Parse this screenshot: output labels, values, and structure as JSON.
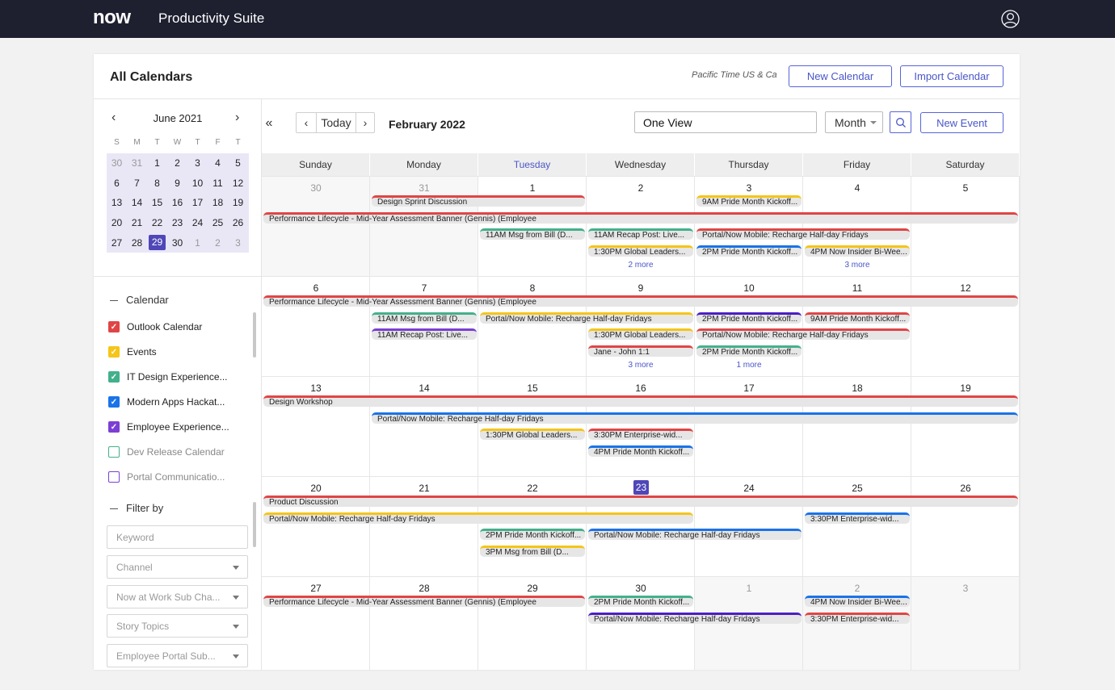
{
  "app": {
    "logo": "now",
    "title": "Productivity Suite"
  },
  "panel": {
    "title": "All Calendars",
    "timezone": "Pacific Time US & Ca",
    "new_calendar": "New Calendar",
    "import_calendar": "Import Calendar"
  },
  "mini_calendar": {
    "month": "June 2021",
    "weekdays": [
      "S",
      "M",
      "T",
      "W",
      "T",
      "F",
      "T"
    ],
    "weeks": [
      [
        "30",
        "31",
        "1",
        "2",
        "3",
        "4",
        "5"
      ],
      [
        "6",
        "7",
        "8",
        "9",
        "10",
        "11",
        "12"
      ],
      [
        "13",
        "14",
        "15",
        "16",
        "17",
        "18",
        "19"
      ],
      [
        "20",
        "21",
        "22",
        "23",
        "24",
        "25",
        "26"
      ],
      [
        "27",
        "28",
        "29",
        "30",
        "1",
        "2",
        "3"
      ]
    ],
    "selected": "29"
  },
  "calendar_section": {
    "title": "Calendar",
    "items": [
      {
        "label": "Outlook Calendar",
        "color": "#e04545",
        "checked": true
      },
      {
        "label": "Events",
        "color": "#f5c518",
        "checked": true
      },
      {
        "label": "IT Design Experience...",
        "color": "#43b08c",
        "checked": true
      },
      {
        "label": "Modern Apps Hackat...",
        "color": "#1a73e8",
        "checked": true
      },
      {
        "label": "Employee Experience...",
        "color": "#7b3fd4",
        "checked": true
      },
      {
        "label": "Dev Release Calendar",
        "color": "#43b08c",
        "checked": false
      },
      {
        "label": "Portal Communicatio...",
        "color": "#7b3fd4",
        "checked": false
      }
    ]
  },
  "filter_section": {
    "title": "Filter by",
    "keyword_placeholder": "Keyword",
    "channel": "Channel",
    "now_at_work": "Now at Work Sub Cha...",
    "story_topics": "Story Topics",
    "employee_portal": "Employee Portal Sub..."
  },
  "toolbar": {
    "today": "Today",
    "period": "February 2022",
    "view_name": "One View",
    "view_mode": "Month",
    "new_event": "New Event"
  },
  "calendar": {
    "weekdays": [
      "Sunday",
      "Monday",
      "Tuesday",
      "Wednesday",
      "Thursday",
      "Friday",
      "Saturday"
    ],
    "today_column": "Tuesday",
    "weeks": [
      {
        "days": [
          "30",
          "31",
          "1",
          "2",
          "3",
          "4",
          "5"
        ],
        "muted": [
          0,
          1
        ],
        "events": [
          {
            "title": "Design Sprint Discussion",
            "start": 1,
            "span": 2,
            "lane": 0,
            "color": "#e04545"
          },
          {
            "title": "9AM Pride Month Kickoff...",
            "start": 4,
            "span": 1,
            "lane": 0,
            "color": "#f5c518"
          },
          {
            "title": "Performance Lifecycle - Mid-Year Assessment Banner (Gennis) (Employee",
            "start": 0,
            "span": 7,
            "lane": 1,
            "color": "#e04545"
          },
          {
            "title": "11AM Msg from Bill (D...",
            "start": 2,
            "span": 1,
            "lane": 2,
            "color": "#43b08c"
          },
          {
            "title": "11AM Recap Post: Live...",
            "start": 3,
            "span": 1,
            "lane": 2,
            "color": "#43b08c"
          },
          {
            "title": "Portal/Now Mobile: Recharge Half-day Fridays",
            "start": 4,
            "span": 2,
            "lane": 2,
            "color": "#e04545"
          },
          {
            "title": "1:30PM Global Leaders...",
            "start": 3,
            "span": 1,
            "lane": 3,
            "color": "#f5c518"
          },
          {
            "title": "2PM Pride Month Kickoff...",
            "start": 4,
            "span": 1,
            "lane": 3,
            "color": "#1a73e8"
          },
          {
            "title": "4PM Now Insider Bi-Wee...",
            "start": 5,
            "span": 1,
            "lane": 3,
            "color": "#f5c518"
          }
        ],
        "more": [
          {
            "col": 3,
            "text": "2 more"
          },
          {
            "col": 5,
            "text": "3 more"
          }
        ]
      },
      {
        "days": [
          "6",
          "7",
          "8",
          "9",
          "10",
          "11",
          "12"
        ],
        "muted": [],
        "events": [
          {
            "title": "Performance Lifecycle - Mid-Year Assessment Banner (Gennis) (Employee",
            "start": 0,
            "span": 7,
            "lane": 0,
            "color": "#e04545"
          },
          {
            "title": "11AM Msg from Bill (D...",
            "start": 1,
            "span": 1,
            "lane": 1,
            "color": "#43b08c"
          },
          {
            "title": "Portal/Now Mobile: Recharge Half-day Fridays",
            "start": 2,
            "span": 2,
            "lane": 1,
            "color": "#f5c518"
          },
          {
            "title": "2PM Pride Month Kickoff...",
            "start": 4,
            "span": 1,
            "lane": 1,
            "color": "#4b1fc4"
          },
          {
            "title": "9AM Pride Month Kickoff...",
            "start": 5,
            "span": 1,
            "lane": 1,
            "color": "#e04545"
          },
          {
            "title": "11AM Recap Post: Live...",
            "start": 1,
            "span": 1,
            "lane": 2,
            "color": "#7b3fd4"
          },
          {
            "title": "1:30PM Global Leaders...",
            "start": 3,
            "span": 1,
            "lane": 2,
            "color": "#f5c518"
          },
          {
            "title": "Portal/Now Mobile: Recharge Half-day Fridays",
            "start": 4,
            "span": 2,
            "lane": 2,
            "color": "#e04545"
          },
          {
            "title": "Jane - John 1:1",
            "start": 3,
            "span": 1,
            "lane": 3,
            "color": "#e04545"
          },
          {
            "title": "2PM Pride Month Kickoff...",
            "start": 4,
            "span": 1,
            "lane": 3,
            "color": "#43b08c"
          }
        ],
        "more": [
          {
            "col": 3,
            "text": "3 more"
          },
          {
            "col": 4,
            "text": "1 more"
          }
        ]
      },
      {
        "days": [
          "13",
          "14",
          "15",
          "16",
          "17",
          "18",
          "19"
        ],
        "muted": [],
        "events": [
          {
            "title": "Design Workshop",
            "start": 0,
            "span": 7,
            "lane": 0,
            "color": "#e04545"
          },
          {
            "title": "Portal/Now Mobile: Recharge Half-day Fridays",
            "start": 1,
            "span": 6,
            "lane": 1,
            "color": "#1a73e8"
          },
          {
            "title": "1:30PM Global Leaders...",
            "start": 2,
            "span": 1,
            "lane": 2,
            "color": "#f5c518"
          },
          {
            "title": "3:30PM Enterprise-wid...",
            "start": 3,
            "span": 1,
            "lane": 2,
            "color": "#e04545"
          },
          {
            "title": "4PM Pride Month Kickoff...",
            "start": 3,
            "span": 1,
            "lane": 3,
            "color": "#1a73e8"
          }
        ],
        "more": []
      },
      {
        "days": [
          "20",
          "21",
          "22",
          "23",
          "24",
          "25",
          "26"
        ],
        "muted": [],
        "current": 3,
        "events": [
          {
            "title": "Product Discussion",
            "start": 0,
            "span": 7,
            "lane": 0,
            "color": "#e04545"
          },
          {
            "title": "Portal/Now Mobile: Recharge Half-day Fridays",
            "start": 0,
            "span": 4,
            "lane": 1,
            "color": "#f5c518"
          },
          {
            "title": "3:30PM Enterprise-wid...",
            "start": 5,
            "span": 1,
            "lane": 1,
            "color": "#1a73e8"
          },
          {
            "title": "2PM Pride Month Kickoff...",
            "start": 2,
            "span": 1,
            "lane": 2,
            "color": "#43b08c"
          },
          {
            "title": "Portal/Now Mobile: Recharge Half-day Fridays",
            "start": 3,
            "span": 2,
            "lane": 2,
            "color": "#1a73e8"
          },
          {
            "title": "3PM Msg from Bill (D...",
            "start": 2,
            "span": 1,
            "lane": 3,
            "color": "#f5c518"
          }
        ],
        "more": []
      },
      {
        "days": [
          "27",
          "28",
          "29",
          "30",
          "1",
          "2",
          "3"
        ],
        "muted": [
          4,
          5,
          6
        ],
        "events": [
          {
            "title": "Performance Lifecycle - Mid-Year Assessment Banner (Gennis) (Employee",
            "start": 0,
            "span": 3,
            "lane": 0,
            "color": "#e04545"
          },
          {
            "title": "2PM Pride Month Kickoff...",
            "start": 3,
            "span": 1,
            "lane": 0,
            "color": "#43b08c"
          },
          {
            "title": "4PM Now Insider Bi-Wee...",
            "start": 5,
            "span": 1,
            "lane": 0,
            "color": "#1a73e8"
          },
          {
            "title": "Portal/Now Mobile: Recharge Half-day Fridays",
            "start": 3,
            "span": 2,
            "lane": 1,
            "color": "#4b1fc4"
          },
          {
            "title": "3:30PM Enterprise-wid...",
            "start": 5,
            "span": 1,
            "lane": 1,
            "color": "#e04545"
          }
        ],
        "more": []
      }
    ]
  }
}
